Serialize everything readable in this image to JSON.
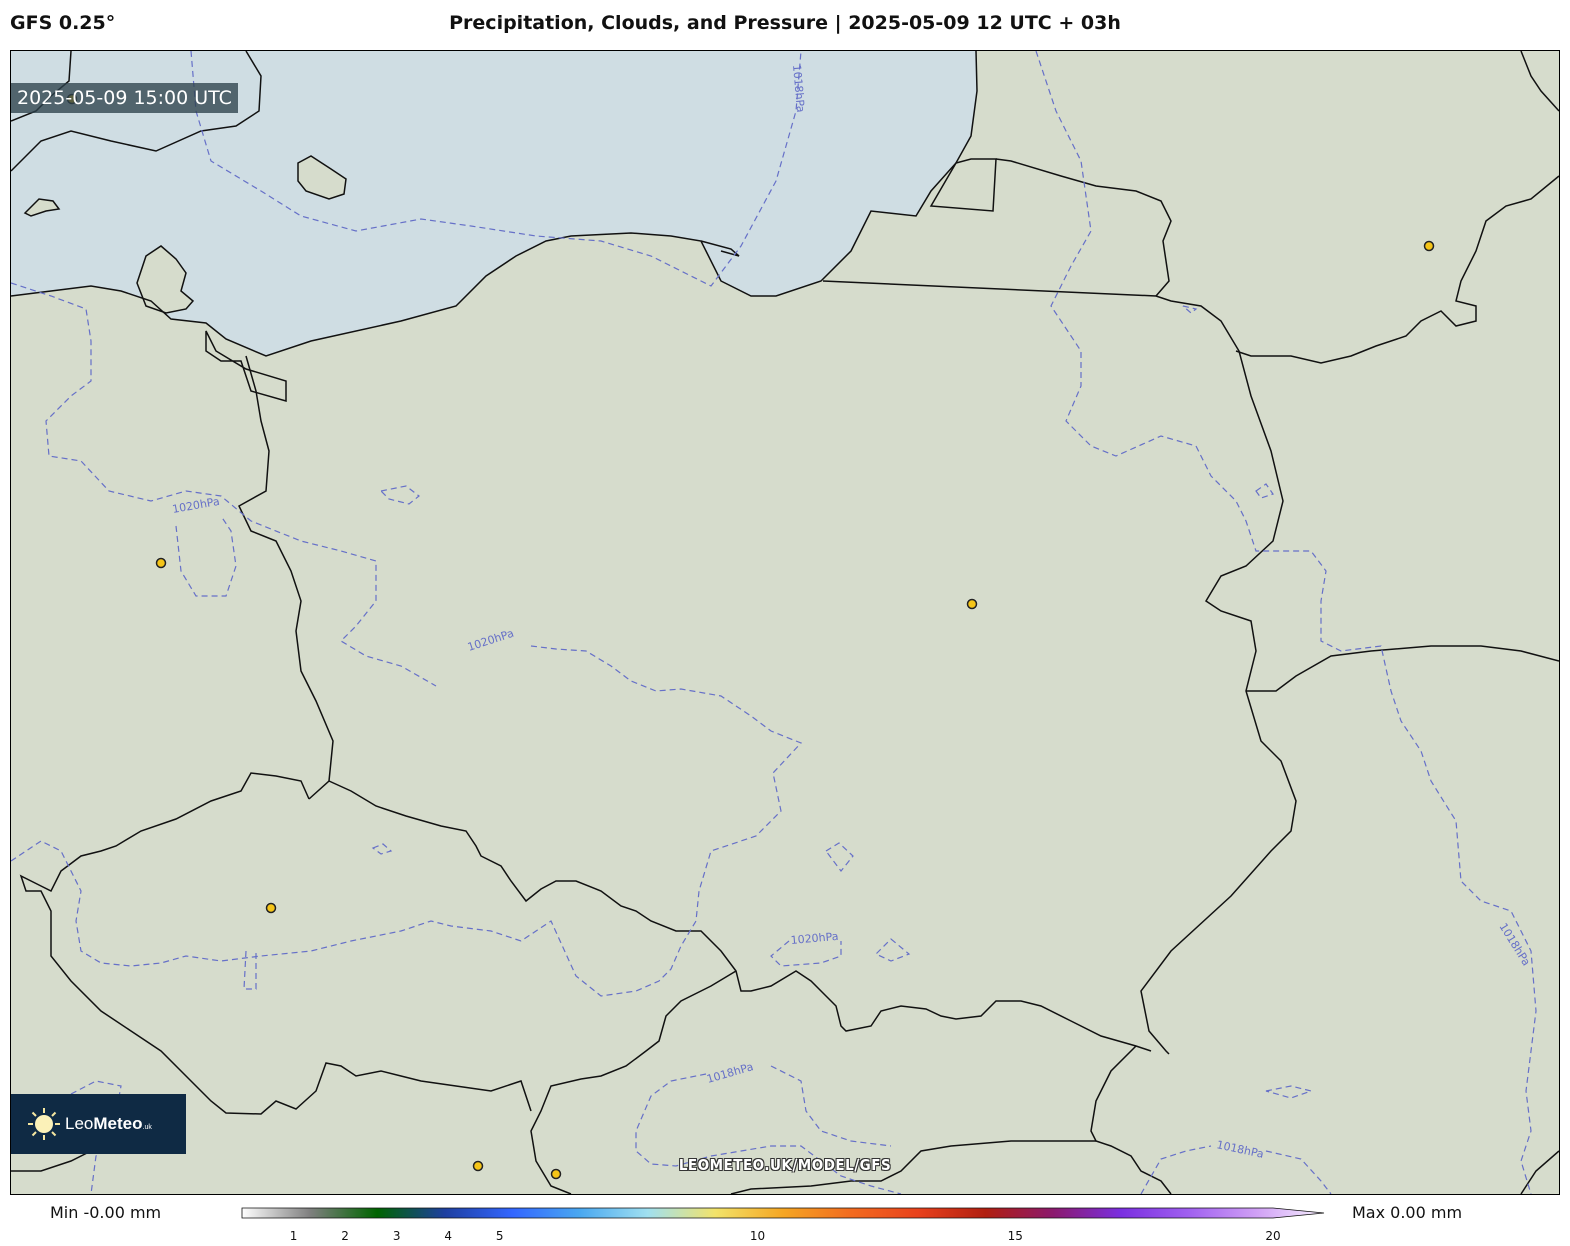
{
  "header": {
    "model": "GFS 0.25°",
    "title": "Precipitation, Clouds, and Pressure | 2025-05-09 12 UTC + 03h"
  },
  "map": {
    "valid_time": "2025-05-09 15:00 UTC",
    "watermark": "LEOMETEO.UK/MODEL/GFS",
    "logo": {
      "name_light": "Leo",
      "name_bold": "Meteo",
      "tld": ".uk"
    },
    "isobar_labels": [
      "1018hPa",
      "1020hPa",
      "1020hPa",
      "1020hPa",
      "1018hPa",
      "1018hPa",
      "1018hPa"
    ],
    "colors": {
      "sea": "#cfdde3",
      "land": "#d6dccc",
      "isobar": "#6670c8",
      "border": "#111111",
      "city_marker": "#f5c518"
    }
  },
  "colorbar": {
    "min_label": "Min -0.00 mm",
    "max_label": "Max 0.00 mm",
    "ticks": [
      "1",
      "2",
      "3",
      "4",
      "5",
      "10",
      "15",
      "20"
    ],
    "tick_values": [
      1,
      2,
      3,
      4,
      5,
      10,
      15,
      20
    ],
    "range": [
      0,
      20
    ],
    "stops": [
      "#ffffff",
      "#808080",
      "#006400",
      "#1e3fa0",
      "#3366ff",
      "#4aa8f0",
      "#a0e0f0",
      "#f2e36a",
      "#f5a623",
      "#f26b1f",
      "#e8411c",
      "#b01e10",
      "#8b1a6e",
      "#7a2fe0",
      "#a060f0",
      "#d0a0f5",
      "#f7f0ff"
    ]
  }
}
